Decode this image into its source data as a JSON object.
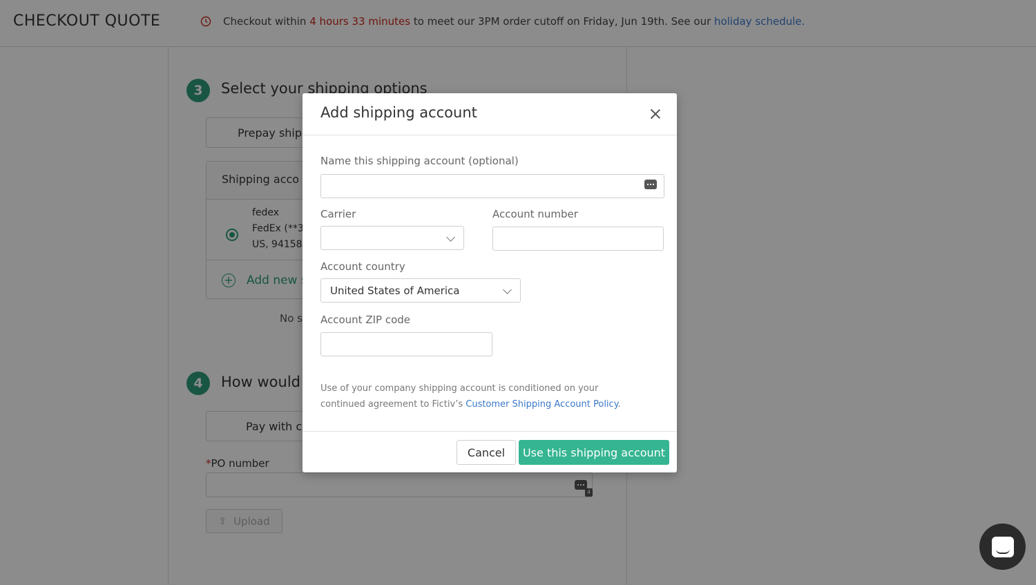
{
  "header": {
    "title": "CHECKOUT QUOTE",
    "cutoff_prefix": "Checkout within",
    "cutoff_time": "4 hours 33 minutes",
    "cutoff_middle": "to meet our 3PM order cutoff on Friday, Jun 19th. See our",
    "holiday_link": "holiday schedule",
    "cutoff_end": "."
  },
  "step3": {
    "number": "3",
    "title": "Select your shipping options",
    "tab_label": "Prepay ship",
    "accounts_header": "Shipping acco",
    "account": {
      "line1": "fedex",
      "line2": "FedEx (**3",
      "line3": "US, 94158"
    },
    "add_new_label": "Add new s",
    "no_ship_text": "No s"
  },
  "step4": {
    "number": "4",
    "title": "How would",
    "tab_label": "Pay with c",
    "po_required": "*",
    "po_label": "PO number",
    "kb_badge": "4",
    "upload_label": "Upload"
  },
  "modal": {
    "title": "Add shipping account",
    "name_label": "Name this shipping account (optional)",
    "name_value": "",
    "carrier_label": "Carrier",
    "carrier_value": "",
    "account_number_label": "Account number",
    "account_number_value": "",
    "country_label": "Account country",
    "country_value": "United States of America",
    "zip_label": "Account ZIP code",
    "zip_value": "",
    "policy_text": "Use of your company shipping account is conditioned on your continued agreement to Fictiv’s",
    "policy_link": "Customer Shipping Account Policy",
    "policy_end": ".",
    "cancel_label": "Cancel",
    "submit_label": "Use this shipping account"
  },
  "colors": {
    "accent": "#35b592",
    "step": "#2f9c7a",
    "alert": "#c6281e",
    "link": "#3a78c9"
  }
}
